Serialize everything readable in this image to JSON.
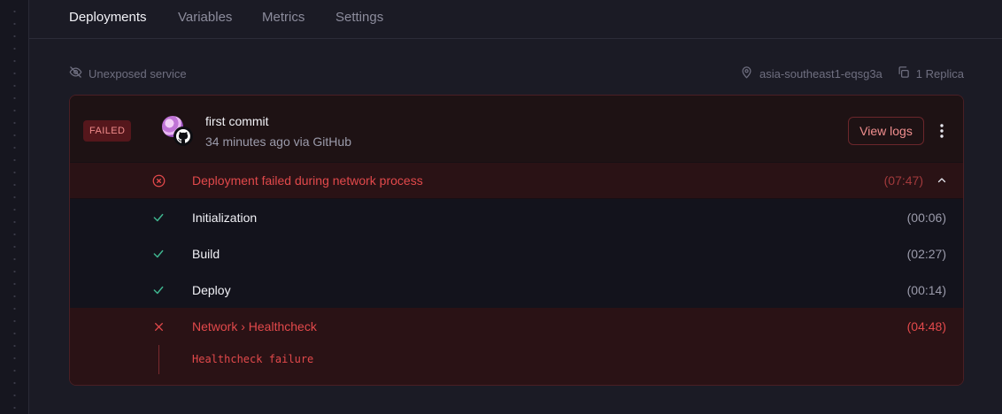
{
  "tabs": [
    {
      "label": "Deployments",
      "active": true
    },
    {
      "label": "Variables",
      "active": false
    },
    {
      "label": "Metrics",
      "active": false
    },
    {
      "label": "Settings",
      "active": false
    }
  ],
  "service": {
    "exposure": "Unexposed service",
    "region": "asia-southeast1-eqsg3a",
    "replicas": "1 Replica"
  },
  "deployment": {
    "status": "FAILED",
    "commit_message": "first commit",
    "meta": "34 minutes ago via GitHub",
    "view_logs_label": "View logs",
    "summary": {
      "message": "Deployment failed during network process",
      "duration": "(07:47)"
    },
    "steps": [
      {
        "name": "Initialization",
        "duration": "(00:06)",
        "status": "success"
      },
      {
        "name": "Build",
        "duration": "(02:27)",
        "status": "success"
      },
      {
        "name": "Deploy",
        "duration": "(00:14)",
        "status": "success"
      }
    ],
    "failed_step": {
      "name": "Network › Healthcheck",
      "duration": "(04:48)",
      "detail": "Healthcheck failure"
    }
  },
  "colors": {
    "danger": "#e2494b",
    "success": "#3fb58f",
    "background": "#1b1b25"
  }
}
